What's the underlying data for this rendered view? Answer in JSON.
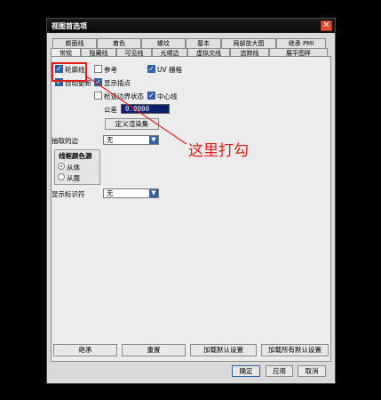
{
  "window": {
    "title": "视图首选项",
    "close": "✕"
  },
  "tabs_row1": [
    "颜面线",
    "着色",
    "螺纹",
    "基本",
    "局部放大图",
    "继承 PMI"
  ],
  "tabs_row2": [
    "常规",
    "隐藏线",
    "可见线",
    "光顺边",
    "虚拟交线",
    "追踪线",
    "展平图样"
  ],
  "options": {
    "contour": "轮廓线",
    "reference": "参考",
    "uv_grid": "UV 栅格",
    "auto_update": "自动更新",
    "show_points": "显示插点",
    "check_boundary": "检查边界状态",
    "centerline": "中心线",
    "tolerance_label": "公差",
    "tolerance_value": "0.0000",
    "custom_render": "定义渲染集"
  },
  "extract_edges": {
    "label": "抽取的边",
    "value": "无"
  },
  "line_color": {
    "title": "线框颜色源",
    "from_body": "从体",
    "from_face": "从面"
  },
  "display_id": {
    "label": "显示标识符",
    "value": "无"
  },
  "annotation": "这里打勾",
  "bottom_buttons": [
    "继承",
    "重置",
    "加载默认设置",
    "加载所有默认设置"
  ],
  "dialog_buttons": {
    "ok": "确定",
    "apply": "应用",
    "cancel": "取消"
  },
  "colors": {
    "highlight": "#e0201a",
    "accent": "#2f5fa8"
  }
}
